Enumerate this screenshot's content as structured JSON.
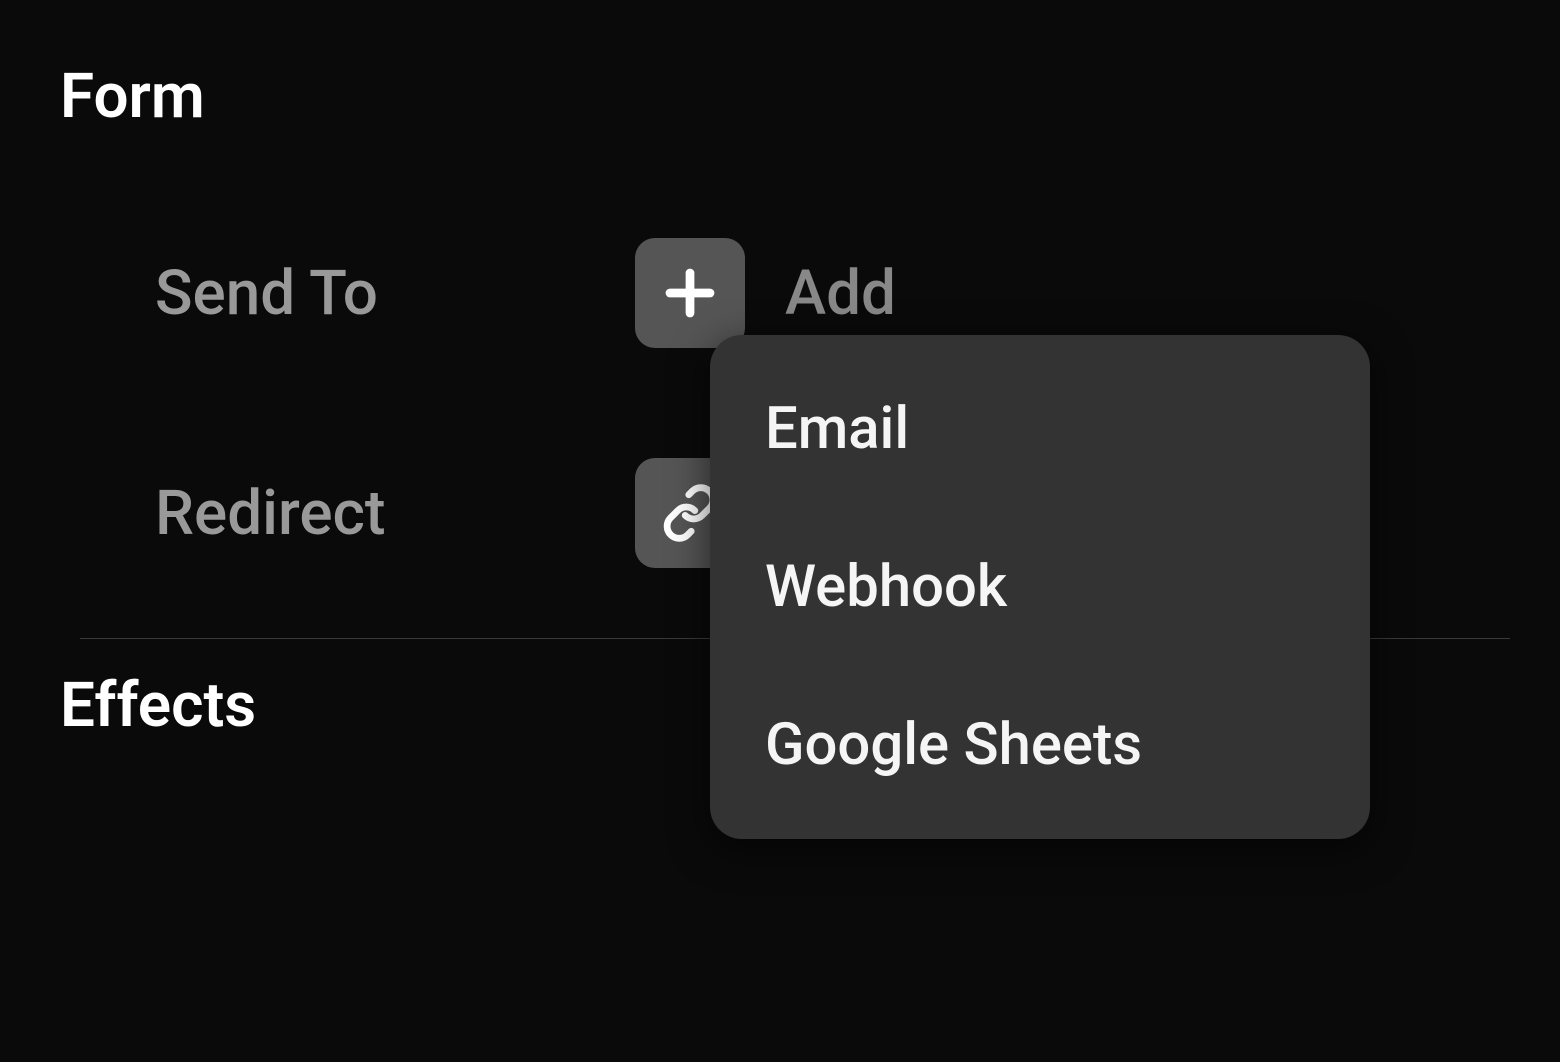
{
  "sections": {
    "form": {
      "title": "Form",
      "fields": {
        "send_to": {
          "label": "Send To",
          "button_label": "Add"
        },
        "redirect": {
          "label": "Redirect"
        }
      }
    },
    "effects": {
      "title": "Effects"
    }
  },
  "dropdown": {
    "options": [
      {
        "label": "Email"
      },
      {
        "label": "Webhook"
      },
      {
        "label": "Google Sheets"
      }
    ]
  }
}
